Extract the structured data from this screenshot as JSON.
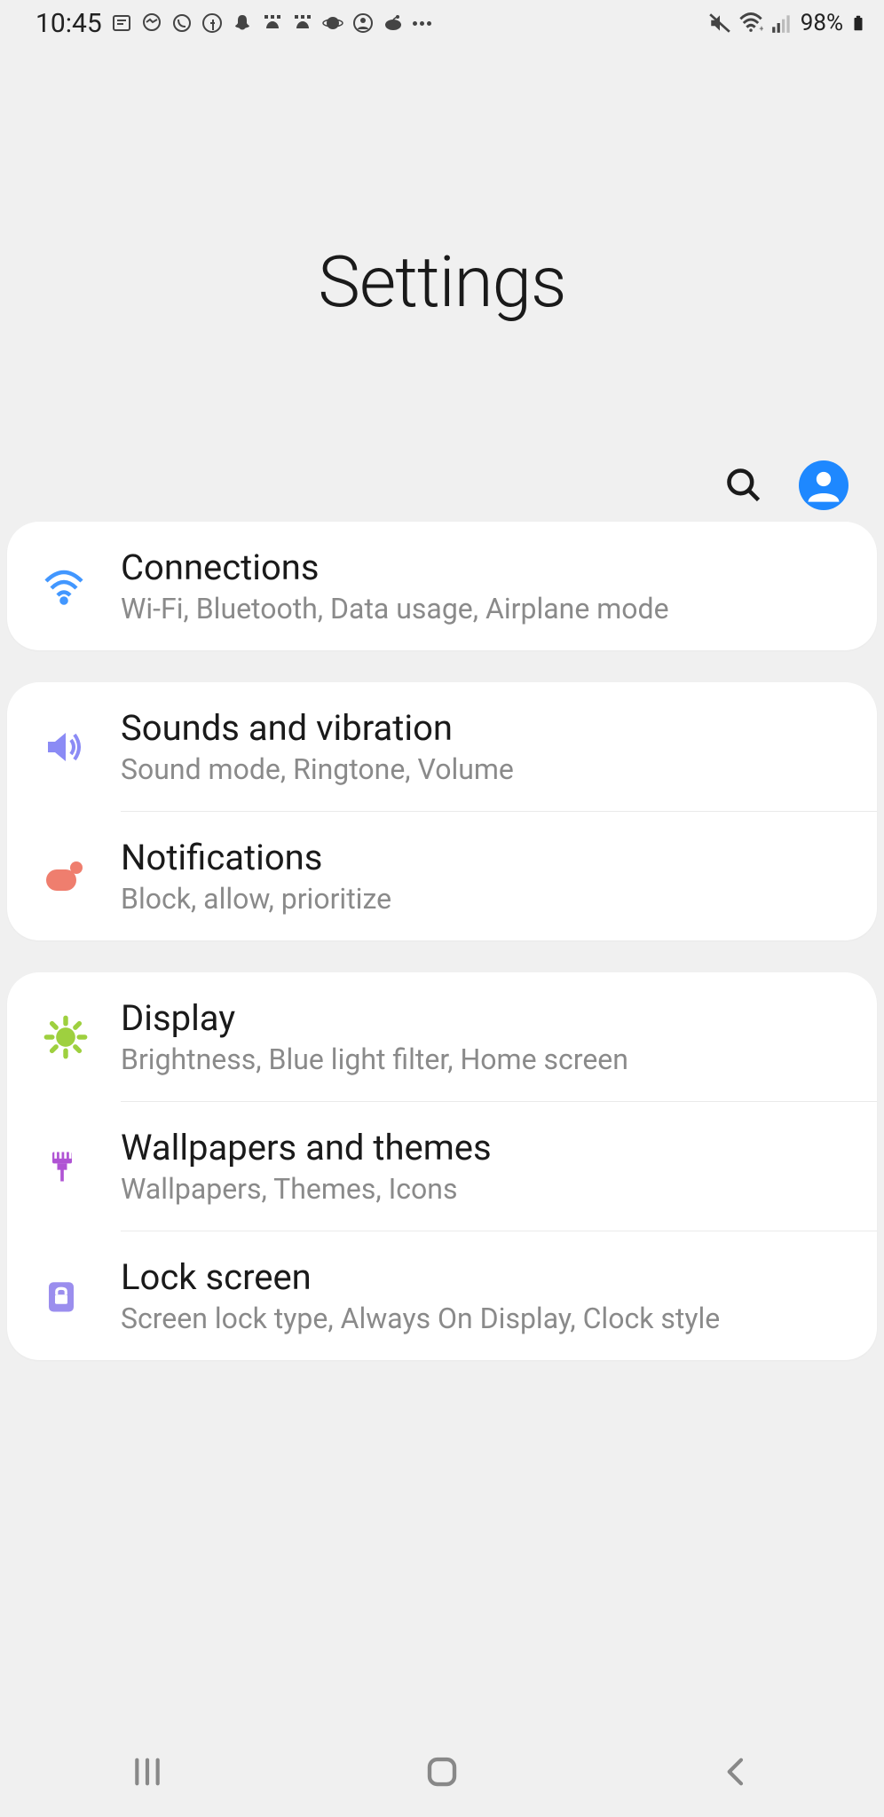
{
  "statusBar": {
    "time": "10:45",
    "batteryPercent": "98%"
  },
  "header": {
    "title": "Settings"
  },
  "groups": [
    {
      "items": [
        {
          "id": "connections",
          "title": "Connections",
          "subtitle": "Wi-Fi, Bluetooth, Data usage, Airplane mode",
          "iconColor": "#4297ff"
        }
      ]
    },
    {
      "items": [
        {
          "id": "sounds",
          "title": "Sounds and vibration",
          "subtitle": "Sound mode, Ringtone, Volume",
          "iconColor": "#8b8bf5"
        },
        {
          "id": "notifications",
          "title": "Notifications",
          "subtitle": "Block, allow, prioritize",
          "iconColor": "#ef7e6e"
        }
      ]
    },
    {
      "items": [
        {
          "id": "display",
          "title": "Display",
          "subtitle": "Brightness, Blue light filter, Home screen",
          "iconColor": "#9ed03f"
        },
        {
          "id": "wallpapers",
          "title": "Wallpapers and themes",
          "subtitle": "Wallpapers, Themes, Icons",
          "iconColor": "#b054d4"
        },
        {
          "id": "lockscreen",
          "title": "Lock screen",
          "subtitle": "Screen lock type, Always On Display, Clock style",
          "iconColor": "#9b8eee"
        }
      ]
    }
  ]
}
